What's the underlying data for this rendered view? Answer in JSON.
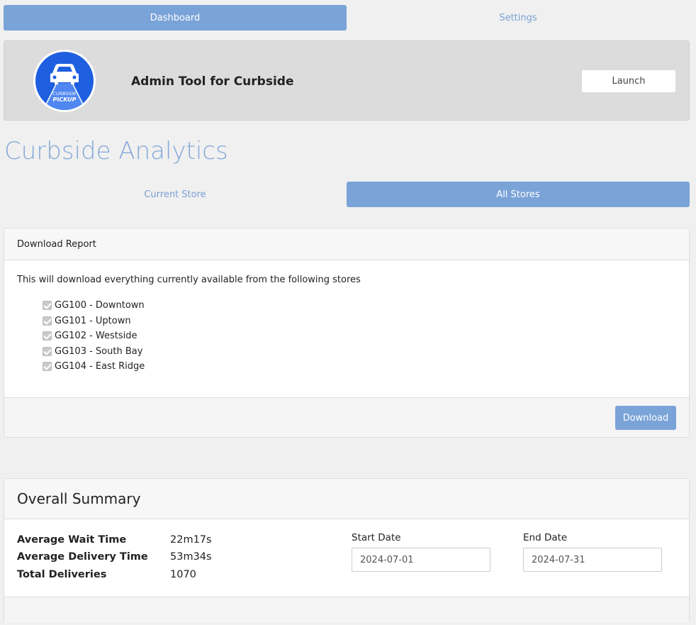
{
  "nav": {
    "tabs": [
      {
        "label": "Dashboard",
        "active": true
      },
      {
        "label": "Settings",
        "active": false
      }
    ]
  },
  "header": {
    "logo_text_top": "CURBSIDE",
    "logo_text_bottom": "PICKUP",
    "app_title": "Admin Tool for Curbside",
    "launch_label": "Launch"
  },
  "page": {
    "title": "Curbside Analytics"
  },
  "subnav": {
    "tabs": [
      {
        "label": "Current Store",
        "active": false
      },
      {
        "label": "All Stores",
        "active": true
      }
    ]
  },
  "download_report": {
    "heading": "Download Report",
    "description": "This will download everything currently available from the following stores",
    "stores": [
      {
        "label": "GG100 - Downtown",
        "checked": true
      },
      {
        "label": "GG101 - Uptown",
        "checked": true
      },
      {
        "label": "GG102 - Westside",
        "checked": true
      },
      {
        "label": "GG103 - South Bay",
        "checked": true
      },
      {
        "label": "GG104 - East Ridge",
        "checked": true
      }
    ],
    "download_label": "Download"
  },
  "summary": {
    "heading": "Overall Summary",
    "stats": [
      {
        "label": "Average Wait Time",
        "value": "22m17s"
      },
      {
        "label": "Average Delivery Time",
        "value": "53m34s"
      },
      {
        "label": "Total Deliveries",
        "value": "1070"
      }
    ],
    "start_date": {
      "label": "Start Date",
      "value": "2024-07-01"
    },
    "end_date": {
      "label": "End Date",
      "value": "2024-07-31"
    }
  },
  "colors": {
    "accent": "#7aa3d8",
    "title": "#86a9d8",
    "logo_blue": "#1e5fe0"
  }
}
